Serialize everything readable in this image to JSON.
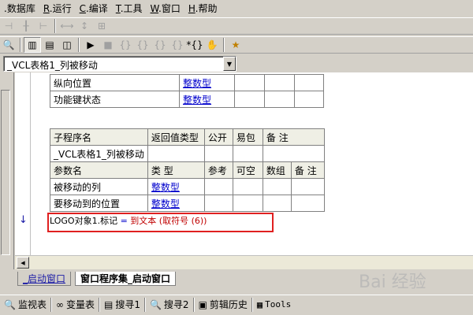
{
  "menu": [
    {
      "label": ".数据库"
    },
    {
      "key": "R",
      "label": ".运行"
    },
    {
      "key": "C",
      "label": ".编译"
    },
    {
      "key": "T",
      "label": ".工具"
    },
    {
      "key": "W",
      "label": ".窗口"
    },
    {
      "key": "H",
      "label": ".帮助"
    }
  ],
  "combo": {
    "value": "_VCL表格1_列被移动"
  },
  "table1": {
    "rows": [
      {
        "name": "纵向位置",
        "type": "整数型"
      },
      {
        "name": "功能键状态",
        "type": "整数型"
      }
    ]
  },
  "table2": {
    "headers": [
      "子程序名",
      "返回值类型",
      "公开",
      "易包",
      "备 注"
    ],
    "name_value": "_VCL表格1_列被移动",
    "param_headers": [
      "参数名",
      "类 型",
      "参考",
      "可空",
      "数组",
      "备 注"
    ],
    "params": [
      {
        "name": "被移动的列",
        "type": "整数型"
      },
      {
        "name": "要移动到的位置",
        "type": "整数型"
      }
    ]
  },
  "code": {
    "obj": "LOGO对象1.标记",
    "op": " = ",
    "fn": "到文本 (取符号 (6))"
  },
  "tabs": [
    {
      "label": "_启动窗口"
    },
    {
      "label": "窗口程序集_启动窗口"
    }
  ],
  "panels": [
    {
      "icon": "magnifier-icon",
      "label": "监视表"
    },
    {
      "icon": "glasses-icon",
      "label": "变量表"
    },
    {
      "icon": "document-search-icon",
      "label": "搜寻1"
    },
    {
      "icon": "magnifier-icon",
      "label": "搜寻2"
    },
    {
      "icon": "clipboard-icon",
      "label": "剪辑历史"
    },
    {
      "icon": "tools-icon",
      "label": "Tools"
    }
  ],
  "watermark": "Bai 经验"
}
